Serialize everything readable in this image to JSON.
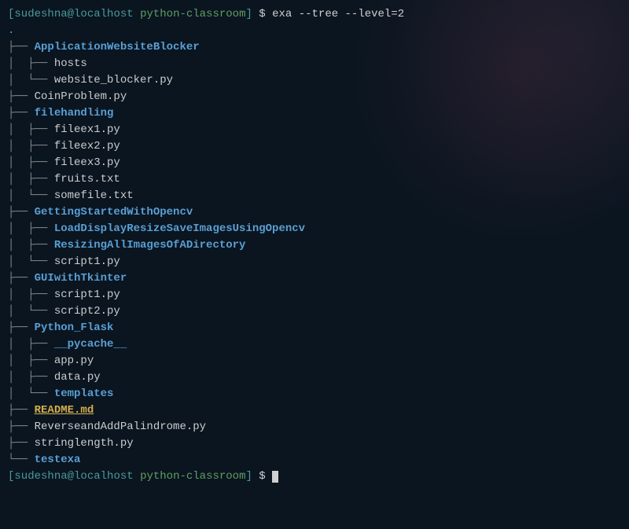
{
  "prompt": {
    "open_bracket": "[",
    "user": "sudeshna",
    "at": "@",
    "host": "localhost",
    "cwd": "python-classroom",
    "close_bracket": "]",
    "dollar": " $ "
  },
  "command": "exa --tree --level=2",
  "root_dot": ".",
  "tree": [
    {
      "prefix": "├── ",
      "type": "dir",
      "name": "ApplicationWebsiteBlocker"
    },
    {
      "prefix": "│  ├── ",
      "type": "file",
      "name": "hosts"
    },
    {
      "prefix": "│  └── ",
      "type": "file",
      "name": "website_blocker.py"
    },
    {
      "prefix": "├── ",
      "type": "file",
      "name": "CoinProblem.py"
    },
    {
      "prefix": "├── ",
      "type": "dir",
      "name": "filehandling"
    },
    {
      "prefix": "│  ├── ",
      "type": "file",
      "name": "fileex1.py"
    },
    {
      "prefix": "│  ├── ",
      "type": "file",
      "name": "fileex2.py"
    },
    {
      "prefix": "│  ├── ",
      "type": "file",
      "name": "fileex3.py"
    },
    {
      "prefix": "│  ├── ",
      "type": "file",
      "name": "fruits.txt"
    },
    {
      "prefix": "│  └── ",
      "type": "file",
      "name": "somefile.txt"
    },
    {
      "prefix": "├── ",
      "type": "dir",
      "name": "GettingStartedWithOpencv"
    },
    {
      "prefix": "│  ├── ",
      "type": "dir",
      "name": "LoadDisplayResizeSaveImagesUsingOpencv"
    },
    {
      "prefix": "│  ├── ",
      "type": "dir",
      "name": "ResizingAllImagesOfADirectory"
    },
    {
      "prefix": "│  └── ",
      "type": "file",
      "name": "script1.py"
    },
    {
      "prefix": "├── ",
      "type": "dir",
      "name": "GUIwithTkinter"
    },
    {
      "prefix": "│  ├── ",
      "type": "file",
      "name": "script1.py"
    },
    {
      "prefix": "│  └── ",
      "type": "file",
      "name": "script2.py"
    },
    {
      "prefix": "├── ",
      "type": "dir",
      "name": "Python_Flask"
    },
    {
      "prefix": "│  ├── ",
      "type": "dir",
      "name": "__pycache__"
    },
    {
      "prefix": "│  ├── ",
      "type": "file",
      "name": "app.py"
    },
    {
      "prefix": "│  ├── ",
      "type": "file",
      "name": "data.py"
    },
    {
      "prefix": "│  └── ",
      "type": "dir",
      "name": "templates"
    },
    {
      "prefix": "├── ",
      "type": "readme",
      "name": "README.md"
    },
    {
      "prefix": "├── ",
      "type": "file",
      "name": "ReverseandAddPalindrome.py"
    },
    {
      "prefix": "├── ",
      "type": "file",
      "name": "stringlength.py"
    },
    {
      "prefix": "└── ",
      "type": "dir",
      "name": "testexa"
    }
  ]
}
